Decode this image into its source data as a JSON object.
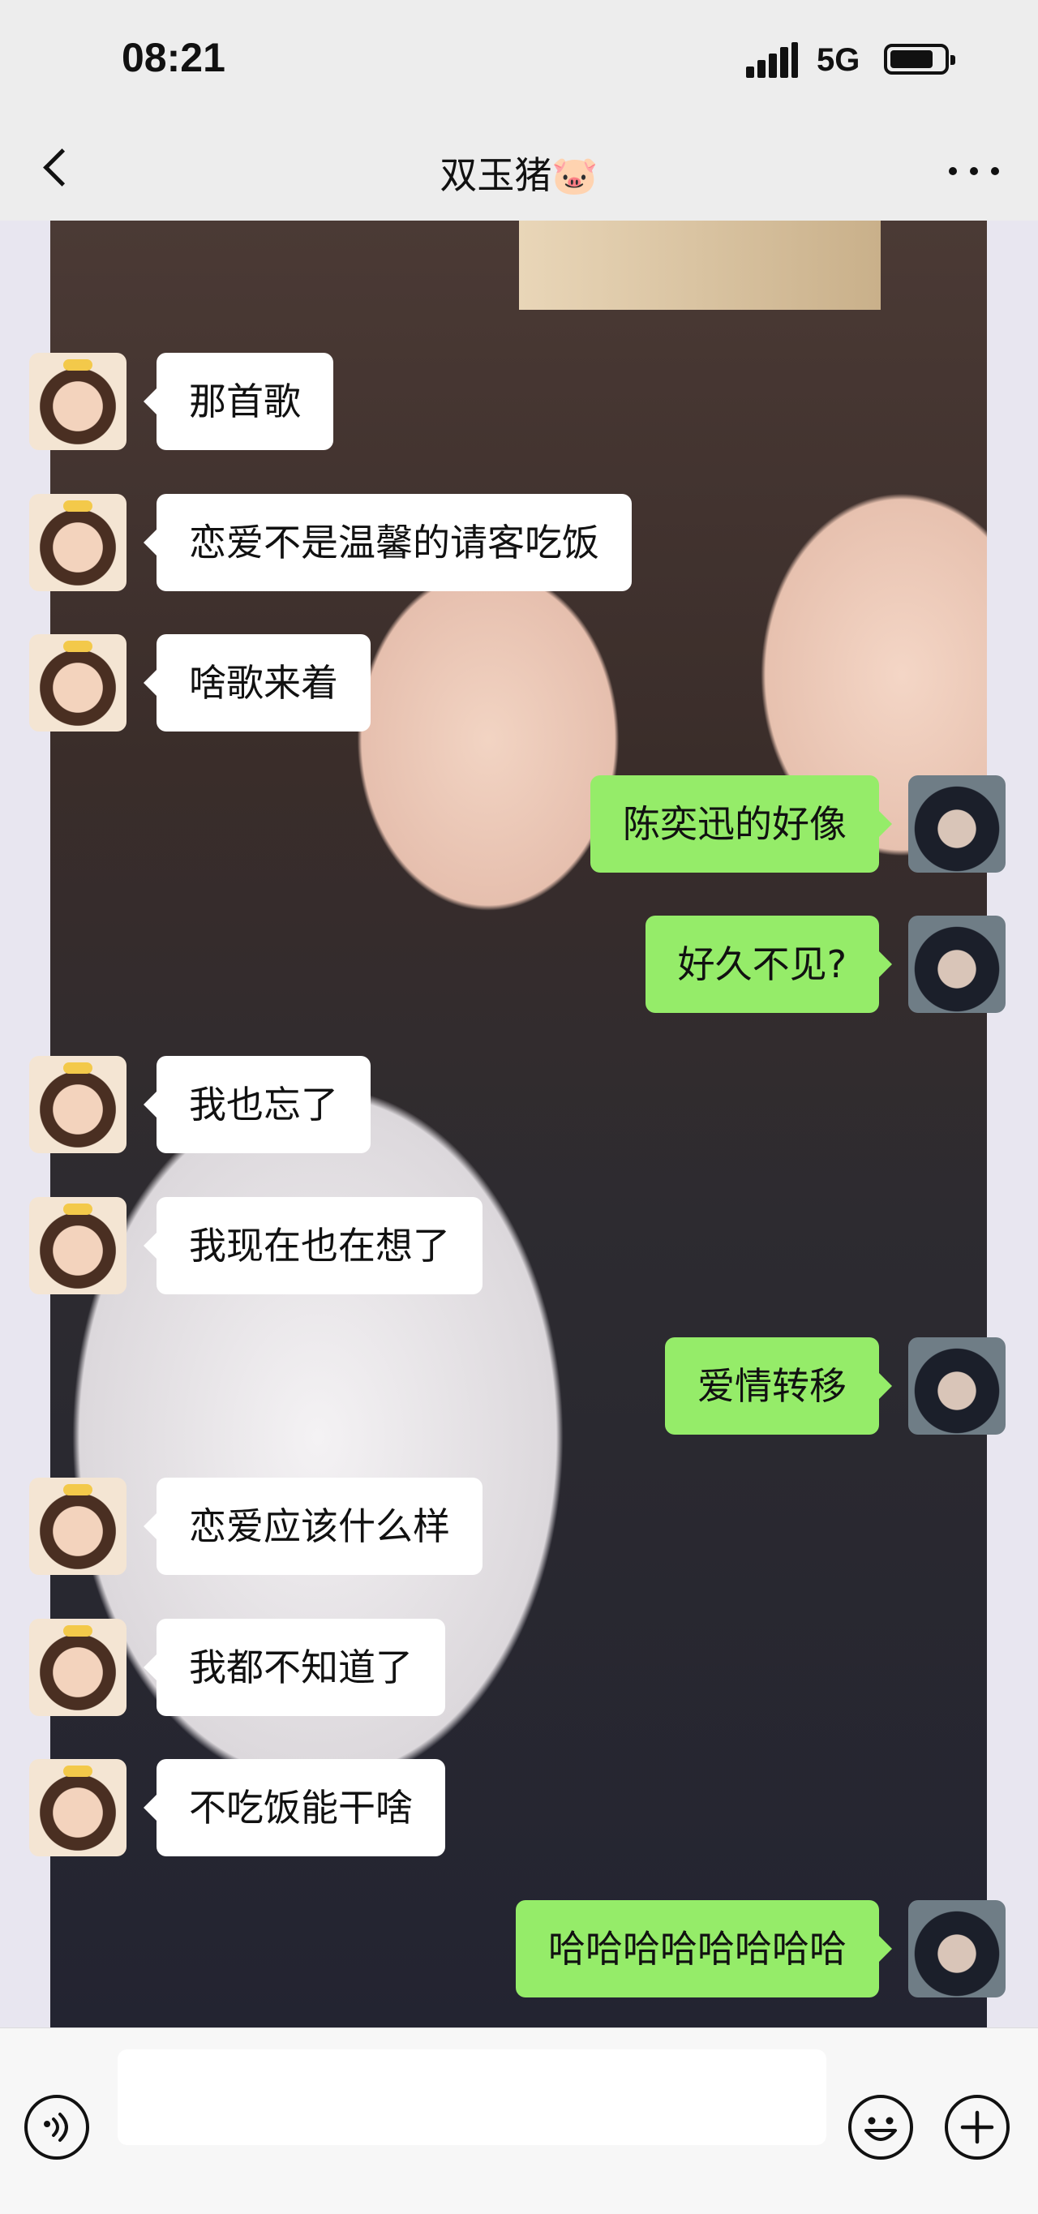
{
  "status_bar": {
    "time": "08:21",
    "network": "5G"
  },
  "header": {
    "title": "双玉猪🐷"
  },
  "messages": [
    {
      "side": "left",
      "text": "那首歌"
    },
    {
      "side": "left",
      "text": "恋爱不是温馨的请客吃饭"
    },
    {
      "side": "left",
      "text": "啥歌来着"
    },
    {
      "side": "right",
      "text": "陈奕迅的好像"
    },
    {
      "side": "right",
      "text": "好久不见?"
    },
    {
      "side": "left",
      "text": "我也忘了"
    },
    {
      "side": "left",
      "text": "我现在也在想了"
    },
    {
      "side": "right",
      "text": "爱情转移"
    },
    {
      "side": "left",
      "text": "恋爱应该什么样"
    },
    {
      "side": "left",
      "text": "我都不知道了"
    },
    {
      "side": "left",
      "text": "不吃饭能干啥"
    },
    {
      "side": "right",
      "text": "哈哈哈哈哈哈哈哈"
    }
  ],
  "input": {
    "value": ""
  },
  "colors": {
    "incoming_bubble": "#ffffff",
    "outgoing_bubble": "#95ec69",
    "bar_background": "#ededed"
  },
  "icons": {
    "back": "chevron-left-icon",
    "more": "more-dots-icon",
    "voice": "voice-icon",
    "emoji": "emoji-icon",
    "plus": "plus-icon"
  }
}
